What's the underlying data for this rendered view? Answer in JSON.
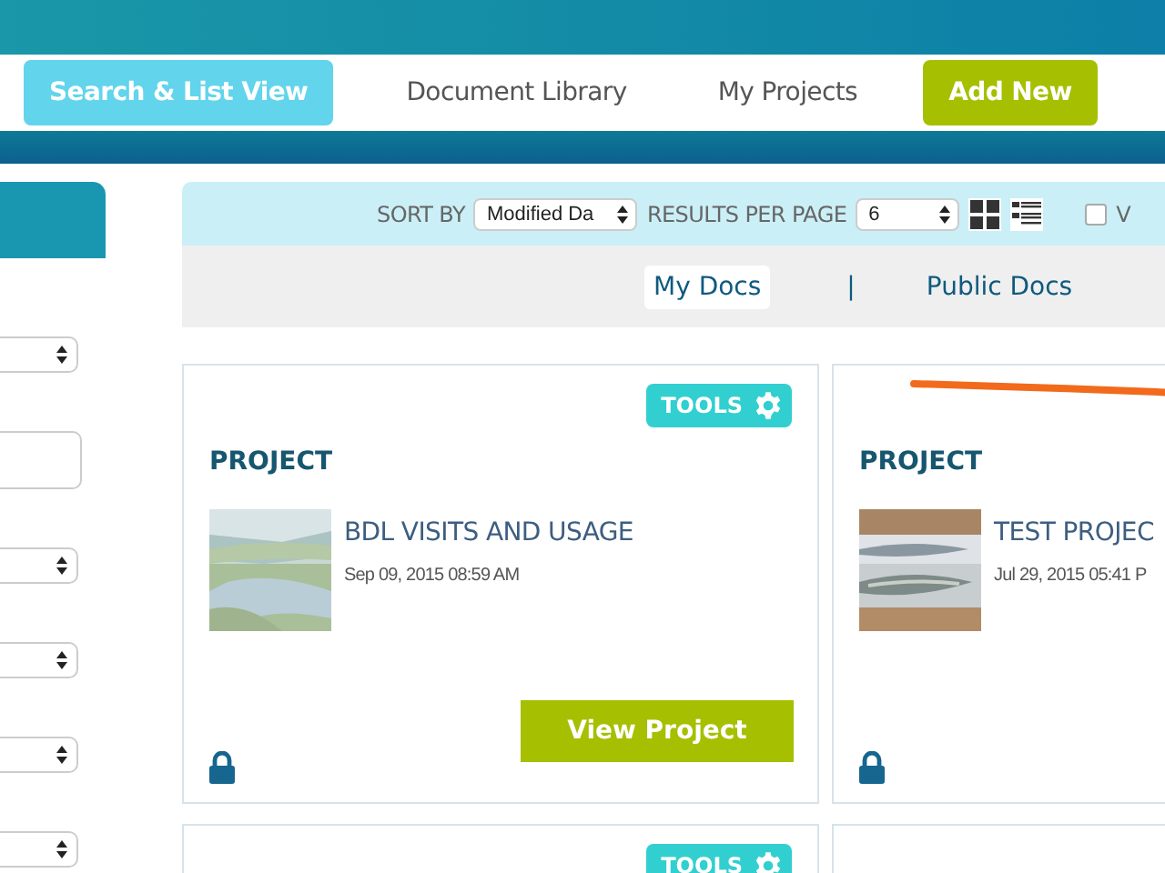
{
  "nav": [
    {
      "label": "Search & List View",
      "kind": "active"
    },
    {
      "label": "Document Library",
      "kind": "link"
    },
    {
      "label": "My Projects",
      "kind": "link"
    },
    {
      "label": "Add New",
      "kind": "accent"
    }
  ],
  "sidebar": {
    "fields": [
      {
        "kind": "select"
      },
      {
        "kind": "input"
      },
      {
        "kind": "select"
      },
      {
        "kind": "select"
      },
      {
        "kind": "select"
      },
      {
        "kind": "select"
      }
    ]
  },
  "toolbar": {
    "sort_label": "SORT BY",
    "sort_value": "Modified Da",
    "per_page_label": "RESULTS PER PAGE",
    "per_page_value": "6",
    "checkbox": {
      "label": "V",
      "checked": false
    }
  },
  "doc_tabs": [
    {
      "label": "My Docs",
      "selected": true
    },
    {
      "label": "Public Docs",
      "selected": false
    }
  ],
  "tab_separator": "|",
  "cards": [
    {
      "tools": "TOOLS",
      "type_label": "PROJECT",
      "title": "BDL VISITS AND USAGE",
      "date": "Sep 09, 2015 08:59 AM",
      "button": "View Project",
      "locked": true
    },
    {
      "type_label": "PROJECT",
      "title": "TEST PROJEC",
      "date": "Jul 29, 2015 05:41 P",
      "locked": true
    }
  ],
  "next_cards": [
    {
      "tools": "TOOLS"
    }
  ]
}
